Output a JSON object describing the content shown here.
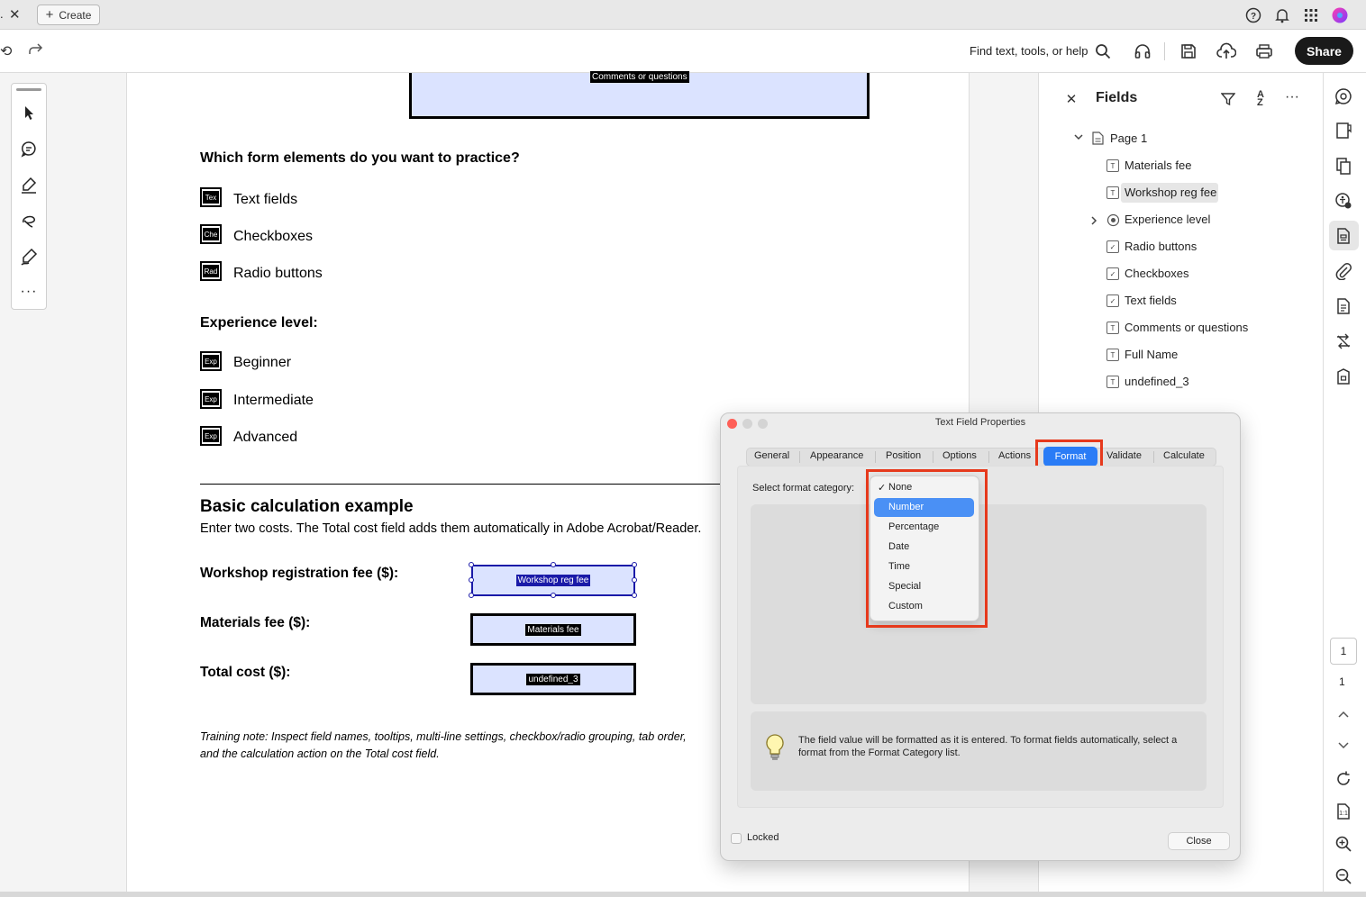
{
  "tabbar": {
    "tab_fragment": ".",
    "create_label": "Create"
  },
  "toolbar": {
    "find_label": "Find text, tools, or help",
    "share_label": "Share"
  },
  "document": {
    "comments_field_tag": "Comments or questions",
    "practice_heading": "Which form elements do you want to practice?",
    "practice_options": [
      {
        "tag": "Tex",
        "label": "Text fields"
      },
      {
        "tag": "Che",
        "label": "Checkboxes"
      },
      {
        "tag": "Rad",
        "label": "Radio buttons"
      }
    ],
    "experience_heading": "Experience level:",
    "experience_options": [
      {
        "tag": "Exp",
        "label": "Beginner"
      },
      {
        "tag": "Exp",
        "label": "Intermediate"
      },
      {
        "tag": "Exp",
        "label": "Advanced"
      }
    ],
    "calc_heading": "Basic calculation example",
    "calc_desc": "Enter two costs. The Total cost field adds them automatically in Adobe Acrobat/Reader.",
    "fees": [
      {
        "label": "Workshop registration fee ($):",
        "field": "Workshop reg fee"
      },
      {
        "label": "Materials fee ($):",
        "field": "Materials fee"
      },
      {
        "label": "Total cost ($):",
        "field": "undefined_3"
      }
    ],
    "training_note_1": "Training note: Inspect field names, tooltips, multi-line settings, checkbox/radio grouping, tab order,",
    "training_note_2": "and the calculation action on the Total cost field."
  },
  "fields_panel": {
    "title": "Fields",
    "page_label": "Page 1",
    "items": [
      {
        "label": "Materials fee"
      },
      {
        "label": "Workshop reg fee"
      },
      {
        "label": "Experience level"
      },
      {
        "label": "Radio buttons"
      },
      {
        "label": "Checkboxes"
      },
      {
        "label": "Text fields"
      },
      {
        "label": "Comments or questions"
      },
      {
        "label": "Full Name"
      },
      {
        "label": "undefined_3"
      }
    ]
  },
  "right_rail": {
    "page_number": "1",
    "page_count": "1"
  },
  "dialog": {
    "title": "Text Field Properties",
    "tabs": [
      "General",
      "Appearance",
      "Position",
      "Options",
      "Actions",
      "Format",
      "Validate",
      "Calculate"
    ],
    "active_tab": "Format",
    "category_label": "Select format category:",
    "dropdown_options": [
      "None",
      "Number",
      "Percentage",
      "Date",
      "Time",
      "Special",
      "Custom"
    ],
    "checked_option": "None",
    "highlighted_option": "Number",
    "hint": "The field value will be formatted as it is entered. To format fields automatically, select a format from the Format Category list.",
    "locked_label": "Locked",
    "close_label": "Close"
  }
}
